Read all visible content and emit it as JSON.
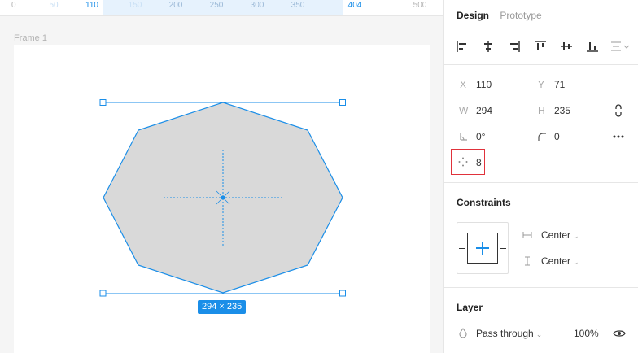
{
  "ruler": {
    "ticks": [
      "0",
      "50",
      "110",
      "150",
      "200",
      "250",
      "300",
      "350",
      "404",
      "500"
    ]
  },
  "canvas": {
    "frame_label": "Frame 1",
    "size_badge": "294 × 235",
    "accent": "#1a8ee8",
    "shape_fill": "#d9d9d9"
  },
  "panel": {
    "tabs": [
      "Design",
      "Prototype"
    ],
    "align_icons": [
      "align-left-icon",
      "align-horizontal-center-icon",
      "align-right-icon",
      "align-top-icon",
      "align-vertical-center-icon",
      "align-bottom-icon",
      "distribute-icon"
    ],
    "props": {
      "x_label": "X",
      "x_value": "110",
      "y_label": "Y",
      "y_value": "71",
      "w_label": "W",
      "w_value": "294",
      "h_label": "H",
      "h_value": "235",
      "rotation_value": "0°",
      "radius_value": "0",
      "points_value": "8"
    },
    "constraints": {
      "title": "Constraints",
      "horizontal": "Center",
      "vertical": "Center"
    },
    "layer": {
      "title": "Layer",
      "blend_mode": "Pass through",
      "opacity": "100%"
    }
  }
}
